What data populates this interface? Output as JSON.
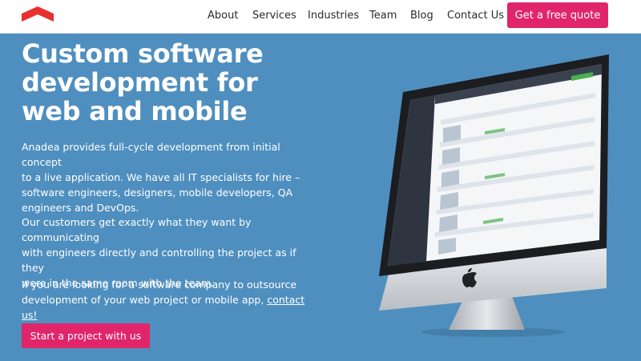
{
  "header": {
    "logo_alt": "Anadea logo",
    "nav": [
      "About",
      "Services",
      "Industries",
      "Team",
      "Blog",
      "Contact Us"
    ],
    "cta_label": "Get a free quote"
  },
  "hero": {
    "title_lines": [
      "Custom software",
      "development for",
      "web and mobile"
    ],
    "paragraph1_lines": [
      "Anadea provides full-cycle development from initial concept",
      "to a live application. We have all IT specialists for hire –",
      "software engineers, designers, mobile developers, QA",
      "engineers and DevOps."
    ],
    "paragraph2_lines": [
      "Our customers get exactly what they want by communicating",
      "with engineers directly and controlling the project as if they",
      "were in the same room with the team."
    ],
    "paragraph3_line1": "If you are looking for a software company to outsource",
    "paragraph3_line2_prefix": "development of your web project or mobile app,",
    "paragraph3_link": "contact us!",
    "button_label": "Start a project with us"
  },
  "colors": {
    "background": "#4f8fbf",
    "accent": "#e0256a",
    "logo_red": "#e8302f"
  },
  "icons": {
    "logo": "roof-logo-icon",
    "device": "apple-logo-icon"
  }
}
